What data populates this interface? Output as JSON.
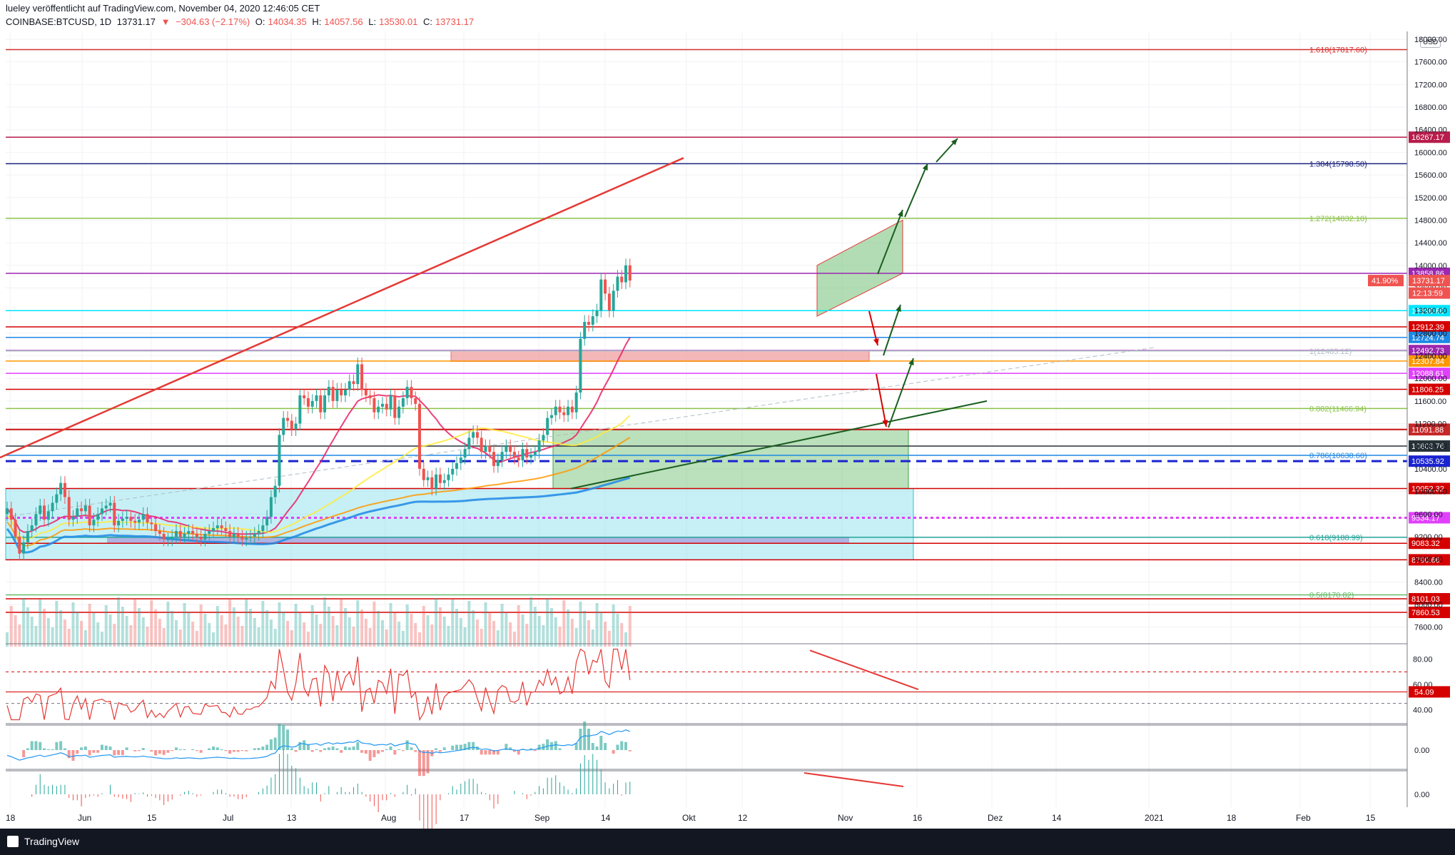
{
  "header": {
    "published": "lueley veröffentlicht auf TradingView.com, November 04, 2020 12:46:05 CET",
    "symbol": "COINBASE:BTCUSD, 1D",
    "last": "13731.17",
    "change": "−304.63 (−2.17%)",
    "open_label": "O:",
    "open": "14034.35",
    "high_label": "H:",
    "high": "14057.56",
    "low_label": "L:",
    "low": "13530.01",
    "close_label": "C:",
    "close": "13731.17"
  },
  "currency": "USD",
  "footer": {
    "brand": "TradingView"
  },
  "colors": {
    "up": "#26a69a",
    "down": "#ef5350",
    "bg": "#ffffff",
    "grid": "#eef0f3"
  },
  "chart_data": {
    "type": "candlestick",
    "x_ticks": [
      "18",
      "Jun",
      "15",
      "Jul",
      "13",
      "Aug",
      "17",
      "Sep",
      "14",
      "Okt",
      "12",
      "Nov",
      "16",
      "Dez",
      "14",
      "2021",
      "18",
      "Feb",
      "15"
    ],
    "y_ticks": [
      7600,
      8000,
      8400,
      8800,
      9200,
      9600,
      10000,
      10400,
      10800,
      11200,
      11600,
      12000,
      12400,
      12800,
      13200,
      13600,
      14000,
      14400,
      14800,
      15200,
      15600,
      16000,
      16400,
      16800,
      17200,
      17600,
      18000
    ],
    "y_range": [
      7450,
      18000
    ],
    "closes": [
      9700,
      9500,
      9200,
      8900,
      9100,
      9300,
      9400,
      9600,
      9750,
      9500,
      9650,
      9800,
      9950,
      10150,
      9900,
      9500,
      9550,
      9700,
      9650,
      9750,
      9400,
      9500,
      9600,
      9700,
      9750,
      9800,
      9400,
      9480,
      9520,
      9550,
      9480,
      9450,
      9500,
      9600,
      9450,
      9420,
      9300,
      9250,
      9150,
      9150,
      9200,
      9300,
      9200,
      9250,
      9300,
      9250,
      9200,
      9150,
      9250,
      9300,
      9350,
      9400,
      9350,
      9300,
      9200,
      9250,
      9200,
      9150,
      9180,
      9200,
      9250,
      9300,
      9400,
      9550,
      9900,
      10100,
      11000,
      11300,
      11250,
      11100,
      11200,
      11700,
      11650,
      11500,
      11600,
      11700,
      11400,
      11700,
      11850,
      11600,
      11800,
      11700,
      11800,
      11950,
      11900,
      12250,
      11800,
      11700,
      11650,
      11400,
      11500,
      11550,
      11450,
      11700,
      11300,
      11500,
      11650,
      11850,
      11650,
      11550,
      10400,
      10200,
      10250,
      10050,
      10300,
      10150,
      10200,
      10300,
      10400,
      10500,
      10600,
      10750,
      10950,
      11050,
      10950,
      10700,
      10800,
      10700,
      10450,
      10550,
      10700,
      10800,
      10700,
      10600,
      10550,
      10750,
      10600,
      10650,
      10700,
      10900,
      11000,
      11300,
      11350,
      11500,
      11400,
      11350,
      11500,
      11400,
      11750,
      12700,
      13000,
      12950,
      13100,
      13200,
      13750,
      13500,
      13200,
      13550,
      13800,
      13700,
      14000,
      13731
    ],
    "levels": [
      {
        "label": "1.618(17817.60)",
        "value": 17817.6,
        "color": "#d32f2f"
      },
      {
        "label": "16267.17",
        "value": 16267.17,
        "color": "#b71c4b"
      },
      {
        "label": "1.384(15798.50)",
        "value": 15798.5,
        "color": "#1a237e"
      },
      {
        "label": "1.272(14832.10)",
        "value": 14832.1,
        "color": "#8bc34a"
      },
      {
        "label": "13858.86",
        "value": 13858.86,
        "color": "#9c27b0"
      },
      {
        "label": "13198.68",
        "value": 13198.68,
        "color": "#00e5ff"
      },
      {
        "label": "12912.39",
        "value": 12912.39,
        "color": "#d50000"
      },
      {
        "label": "12724.74",
        "value": 12724.74,
        "color": "#1e88e5"
      },
      {
        "label": "12492.73",
        "value": 12492.73,
        "color": "#9c27b0"
      },
      {
        "label": "12307.84",
        "value": 12307.84,
        "color": "#ff9800"
      },
      {
        "label": "12088.61",
        "value": 12088.61,
        "color": "#e040fb"
      },
      {
        "label": "11806.25",
        "value": 11806.25,
        "color": "#d50000"
      },
      {
        "label": "0.882(11466.94)",
        "value": 11466.94,
        "color": "#8bc34a"
      },
      {
        "label": "11099.31",
        "value": 11099.31,
        "color": "#d50000"
      },
      {
        "label": "11091.88",
        "value": 11091.88,
        "color": "#c62828"
      },
      {
        "label": "10803.76",
        "value": 10803.76,
        "color": "#263238"
      },
      {
        "label": "0.786(10638.60)",
        "value": 10638.6,
        "color": "#1e88e5"
      },
      {
        "label": "10535.92",
        "value": 10535.92,
        "color": "#1a23d0"
      },
      {
        "label": "10052.32",
        "value": 10052.32,
        "color": "#d50000"
      },
      {
        "label": "9534.17",
        "value": 9534.17,
        "color": "#e040fb"
      },
      {
        "label": "0.618(9188.99)",
        "value": 9188.99,
        "color": "#26a69a"
      },
      {
        "label": "9083.32",
        "value": 9083.32,
        "color": "#d50000"
      },
      {
        "label": "8790.66",
        "value": 8790.66,
        "color": "#d50000"
      },
      {
        "label": "0.5(8170.82)",
        "value": 8170.82,
        "color": "#66bb6a"
      },
      {
        "label": "8101.03",
        "value": 8101.03,
        "color": "#d50000"
      },
      {
        "label": "7860.53",
        "value": 7860.53,
        "color": "#d50000"
      },
      {
        "label": "1(12485.12)",
        "value": 12485.12,
        "color": "#b0bec5"
      }
    ],
    "price_tags": [
      {
        "label": "13731.17",
        "value": 13731.17,
        "color": "#ef5350"
      },
      {
        "label": "41.90%",
        "value": 13731.17,
        "color": "#ef5350"
      },
      {
        "label": "12:13:59",
        "value": 13510,
        "color": "#ef5350"
      }
    ],
    "rsi": {
      "ticks": [
        "80.00",
        "60.00",
        "40.00"
      ],
      "last_label": "54.09"
    },
    "macd": {
      "ticks": [
        "0.00"
      ]
    },
    "osc": {
      "ticks": [
        "0.00"
      ]
    }
  }
}
